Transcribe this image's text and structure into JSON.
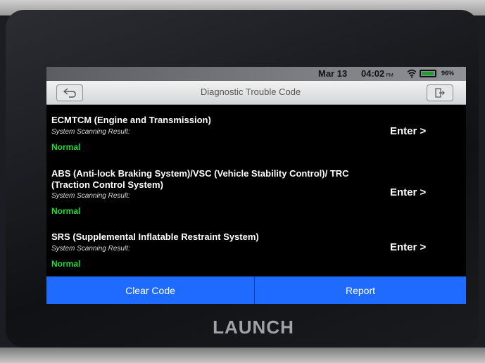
{
  "statusbar": {
    "date": "Mar 13",
    "time": "04:02",
    "ampm": "PM",
    "battery": "96%",
    "battery_level": 0.96,
    "icons": [
      "wifi-icon",
      "battery-icon"
    ]
  },
  "header": {
    "title": "Diagnostic Trouble Code",
    "back_icon": "back-arrow-icon",
    "exit_icon": "exit-icon"
  },
  "systems": [
    {
      "name": "ECMTCM (Engine and Transmission)",
      "result_label": "System Scanning Result:",
      "result": "Normal",
      "enter": "Enter >"
    },
    {
      "name": "ABS (Anti-lock Braking System)/VSC (Vehicle Stability Control)/ TRC (Traction Control System)",
      "result_label": "System Scanning Result:",
      "result": "Normal",
      "enter": "Enter >"
    },
    {
      "name": "SRS (Supplemental Inflatable Restraint System)",
      "result_label": "System Scanning Result:",
      "result": "Normal",
      "enter": "Enter >"
    }
  ],
  "actions": {
    "clear_code": "Clear Code",
    "report": "Report"
  },
  "brand": "LAUNCH",
  "colors": {
    "accent": "#1f6bff",
    "normal_status": "#22dd3a"
  }
}
